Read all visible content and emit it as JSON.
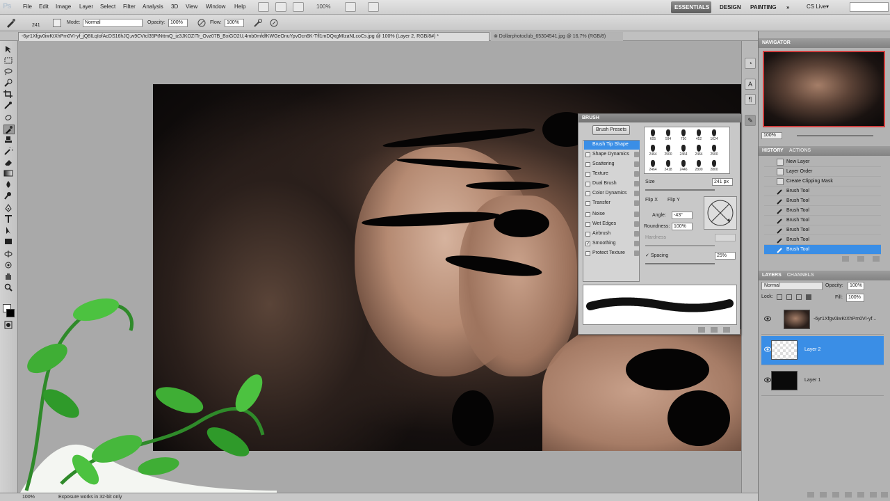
{
  "app": {
    "logo": "Ps"
  },
  "menu": [
    "File",
    "Edit",
    "Image",
    "Layer",
    "Select",
    "Filter",
    "Analysis",
    "3D",
    "View",
    "Window",
    "Help"
  ],
  "menubar": {
    "zoom": "100%"
  },
  "workspaces": {
    "essentials": "ESSENTIALS",
    "design": "DESIGN",
    "painting": "PAINTING",
    "more": "»",
    "cslive": "CS Live▾"
  },
  "options": {
    "brush_size": "241",
    "mode_label": "Mode:",
    "mode_value": "Normal",
    "opacity_label": "Opacity:",
    "opacity_value": "100%",
    "flow_label": "Flow:",
    "flow_value": "100%"
  },
  "tabs": [
    {
      "label": "-6yr1Xfgv0iwKtXhPm0VI-yf_jQ8ILqIofAcDS16hJQ,w9CVtcl35PtNttmQ_iz3JKOZITr_Ovz07B_BxiGO2U,4mb0mfdfKWGeOnuYpvOcn6K-Tfl1mDQxgMIzaNLcoCs.jpg @ 100% (Layer 2, RGB/8#) *"
    },
    {
      "label": "⊗ Dollarphotoclub_65304541.jpg @ 16,7% (RGB/8)"
    }
  ],
  "navigator": {
    "title": "NAVIGATOR",
    "zoom": "100%"
  },
  "history": {
    "tabs": [
      "HISTORY",
      "ACTIONS"
    ],
    "items": [
      "New Layer",
      "Layer Order",
      "Create Clipping Mask",
      "Brush Tool",
      "Brush Tool",
      "Brush Tool",
      "Brush Tool",
      "Brush Tool",
      "Brush Tool",
      "Brush Tool"
    ]
  },
  "layers": {
    "tabs": [
      "LAYERS",
      "CHANNELS"
    ],
    "mode": "Normal",
    "opacity_label": "Opacity:",
    "opacity": "100%",
    "lock_label": "Lock:",
    "fill_label": "Fill:",
    "fill": "100%",
    "items": [
      {
        "name": "-6yr1Xfgv0iwKtXhPm0VI-yf..."
      },
      {
        "name": "Layer 2"
      },
      {
        "name": "Layer 1"
      }
    ]
  },
  "brush_panel": {
    "title": "BRUSH",
    "presets_button": "Brush Presets",
    "options": [
      {
        "label": "Brush Tip Shape",
        "checked": false
      },
      {
        "label": "Shape Dynamics",
        "checked": false
      },
      {
        "label": "Scattering",
        "checked": false
      },
      {
        "label": "Texture",
        "checked": false
      },
      {
        "label": "Dual Brush",
        "checked": false
      },
      {
        "label": "Color Dynamics",
        "checked": false
      },
      {
        "label": "Transfer",
        "checked": false
      },
      {
        "label": "Noise",
        "checked": false
      },
      {
        "label": "Wet Edges",
        "checked": false
      },
      {
        "label": "Airbrush",
        "checked": false
      },
      {
        "label": "Smoothing",
        "checked": true
      },
      {
        "label": "Protect Texture",
        "checked": false
      }
    ],
    "tips": [
      "605",
      "594",
      "750",
      "452",
      "1024",
      "2464",
      "2500",
      "2464",
      "2464",
      "2500",
      "2464",
      "2418",
      "2446",
      "2800",
      "2800"
    ],
    "size_label": "Size",
    "size_value": "241 px",
    "flipx": "Flip X",
    "flipy": "Flip Y",
    "angle_label": "Angle:",
    "angle_value": "-43°",
    "roundness_label": "Roundness:",
    "roundness_value": "100%",
    "hardness_label": "Hardness",
    "spacing_label": "Spacing",
    "spacing_value": "25%"
  },
  "status": {
    "zoom": "100%",
    "message": "Exposure works in 32-bit only"
  },
  "colors": {
    "accent": "#3a8ee6",
    "panel": "#b3b3b3"
  }
}
